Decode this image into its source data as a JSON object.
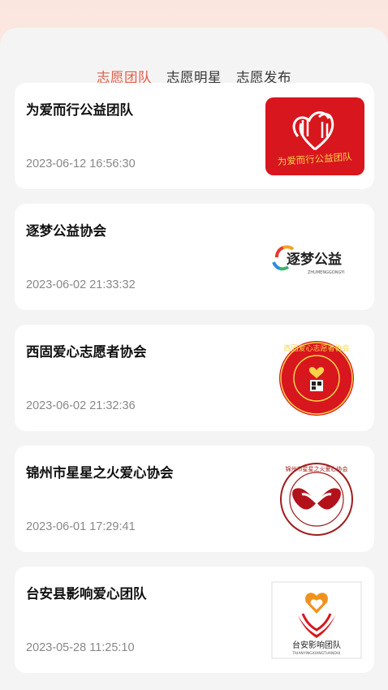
{
  "tabs": [
    {
      "label": "志愿团队",
      "active": true
    },
    {
      "label": "志愿明星",
      "active": false
    },
    {
      "label": "志愿发布",
      "active": false
    }
  ],
  "teams": [
    {
      "name": "为爱而行公益团队",
      "date": "2023-06-12 16:56:30",
      "logo": "red-heart-hands-logo",
      "logo_text": "为爱而行公益团队"
    },
    {
      "name": "逐梦公益协会",
      "date": "2023-06-02 21:33:32",
      "logo": "zhumeng-logo",
      "logo_text": "逐梦公益",
      "logo_subtext": "ZHUMENGGONGYI"
    },
    {
      "name": "西固爱心志愿者协会",
      "date": "2023-06-02 21:32:36",
      "logo": "round-seal-logo",
      "logo_text": "西固爱心志愿者协会"
    },
    {
      "name": "锦州市星星之火爱心协会",
      "date": "2023-06-01 17:29:41",
      "logo": "ribbon-circle-logo",
      "logo_text": "锦州市星星之火爱心协会"
    },
    {
      "name": "台安县影响爱心团队",
      "date": "2023-05-28 11:25:10",
      "logo": "heart-flame-logo",
      "logo_text": "台安影响团队",
      "logo_subtext": "TAIANYINGXIANGTUANDUI"
    }
  ],
  "colors": {
    "accent": "#e45b45",
    "logo_red": "#d8161d",
    "text_gray": "#888888"
  }
}
